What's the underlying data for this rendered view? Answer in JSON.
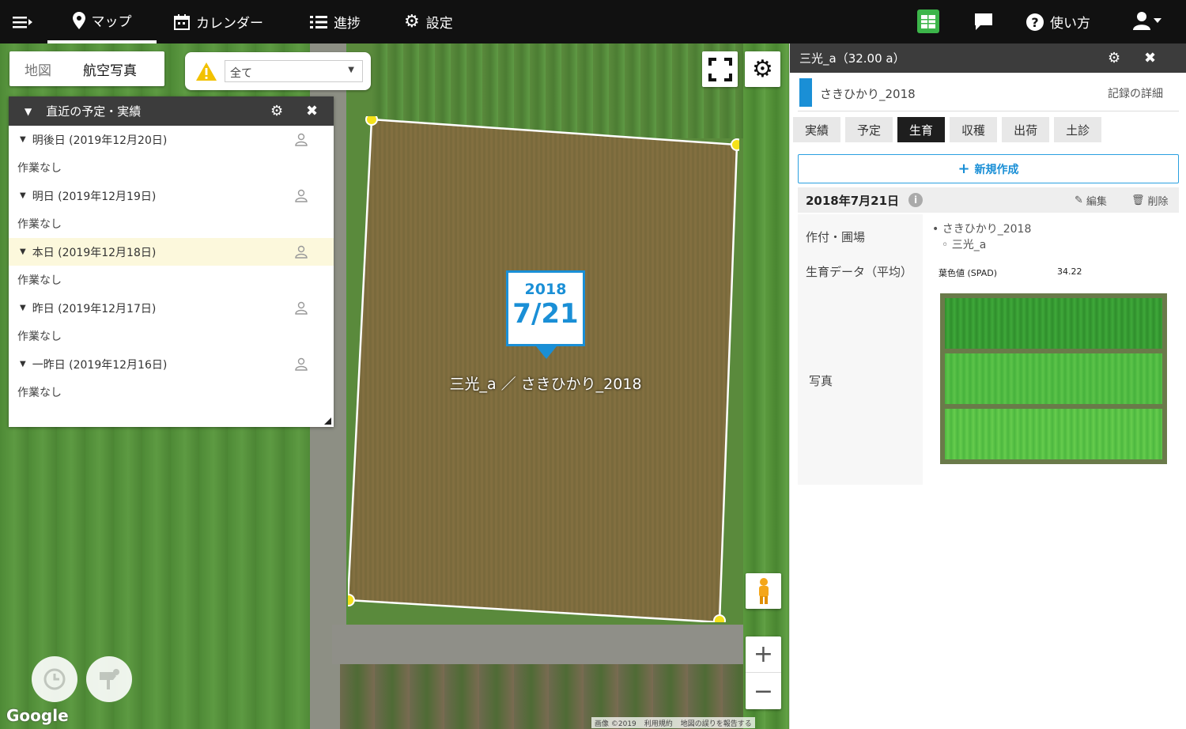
{
  "nav": {
    "map": "マップ",
    "calendar": "カレンダー",
    "progress": "進捗",
    "settings": "設定",
    "help": "使い方"
  },
  "map": {
    "toggle": {
      "map": "地図",
      "aerial": "航空写真"
    },
    "filter_value": "全て",
    "field_label": "三光_a ／ さきひかり_2018",
    "marker": {
      "year": "2018",
      "date": "7/21"
    },
    "google": "Google",
    "attribution": [
      "画像 ©2019",
      "利用規約",
      "地図の誤りを報告する"
    ]
  },
  "schedule": {
    "title": "直近の予定・実績",
    "days": [
      {
        "label": "明後日 (2019年12月20日)",
        "note": "作業なし",
        "today": false
      },
      {
        "label": "明日 (2019年12月19日)",
        "note": "作業なし",
        "today": false
      },
      {
        "label": "本日 (2019年12月18日)",
        "note": "作業なし",
        "today": true
      },
      {
        "label": "昨日 (2019年12月17日)",
        "note": "作業なし",
        "today": false
      },
      {
        "label": "一昨日 (2019年12月16日)",
        "note": "作業なし",
        "today": false
      }
    ]
  },
  "panel": {
    "title": "三光_a（32.00 a）",
    "crop": "さきひかり_2018",
    "detail_link": "記録の詳細",
    "tabs": [
      "実績",
      "予定",
      "生育",
      "収穫",
      "出荷",
      "土診"
    ],
    "active_tab": "生育",
    "new_button": "新規作成",
    "record_date": "2018年7月21日",
    "edit": "編集",
    "delete": "削除",
    "labels": {
      "crop_field": "作付・圃場",
      "growth": "生育データ（平均）",
      "photo": "写真"
    },
    "crop_field_values": [
      "さきひかり_2018",
      "三光_a"
    ],
    "growth_metric": "葉色値 (SPAD)",
    "growth_value": "34.22"
  },
  "colors": {
    "accent": "#1a8fd6",
    "nav_bg": "#111111",
    "panel_header": "#3c3c3c",
    "highlight": "#fcf8dc",
    "marker_blue": "#1a8fd6"
  }
}
